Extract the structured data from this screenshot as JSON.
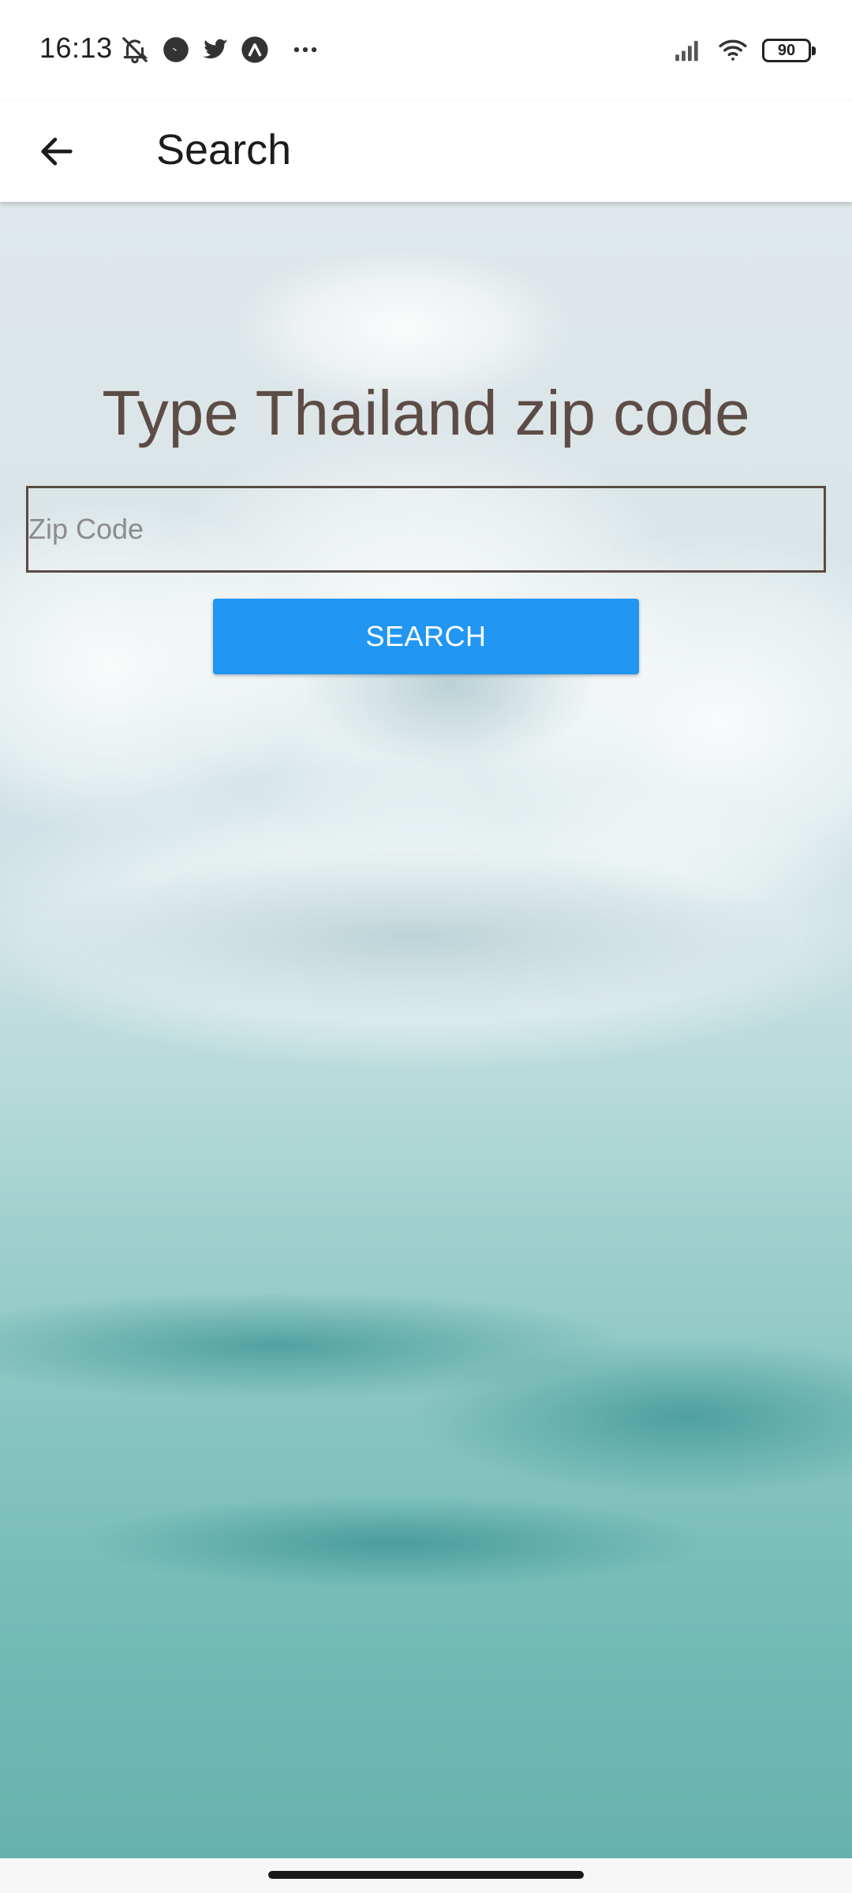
{
  "status_bar": {
    "time": "16:13",
    "battery": "90",
    "icons": [
      "bell-off-icon",
      "messenger-icon",
      "twitter-icon",
      "app-logo-icon",
      "more-icon",
      "signal-icon",
      "wifi-icon",
      "battery-icon"
    ]
  },
  "app_bar": {
    "title": "Search",
    "back_icon": "arrow-left-icon"
  },
  "main": {
    "heading": "Type Thailand zip code",
    "zip_input": {
      "placeholder": "Zip Code",
      "value": ""
    },
    "search_button_label": "SEARCH"
  },
  "colors": {
    "accent": "#2196f3",
    "heading_text": "#5d4c46",
    "input_border": "#5a4a44"
  }
}
